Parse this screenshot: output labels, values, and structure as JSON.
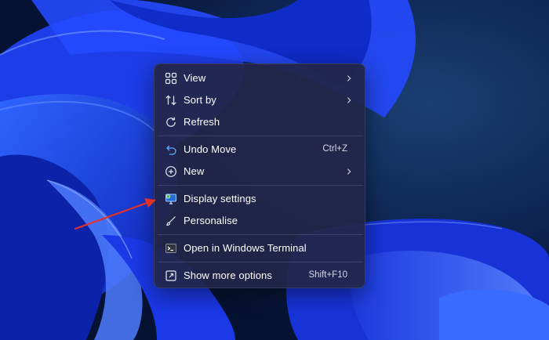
{
  "menu": {
    "view_label": "View",
    "sort_label": "Sort by",
    "refresh_label": "Refresh",
    "undo_label": "Undo Move",
    "undo_shortcut": "Ctrl+Z",
    "new_label": "New",
    "display_label": "Display settings",
    "personalise_label": "Personalise",
    "terminal_label": "Open in Windows Terminal",
    "more_label": "Show more options",
    "more_shortcut": "Shift+F10"
  },
  "icons": {
    "view": "view-grid-icon",
    "sort": "sort-arrows-icon",
    "refresh": "refresh-icon",
    "undo": "undo-icon",
    "new": "plus-circle-icon",
    "display": "display-settings-icon",
    "personalise": "brush-icon",
    "terminal": "terminal-icon",
    "more": "show-more-icon"
  },
  "colors": {
    "menu_background": "#222648",
    "annotation_arrow": "#e0322a",
    "wallpaper_blue": "#1f4cf0"
  }
}
